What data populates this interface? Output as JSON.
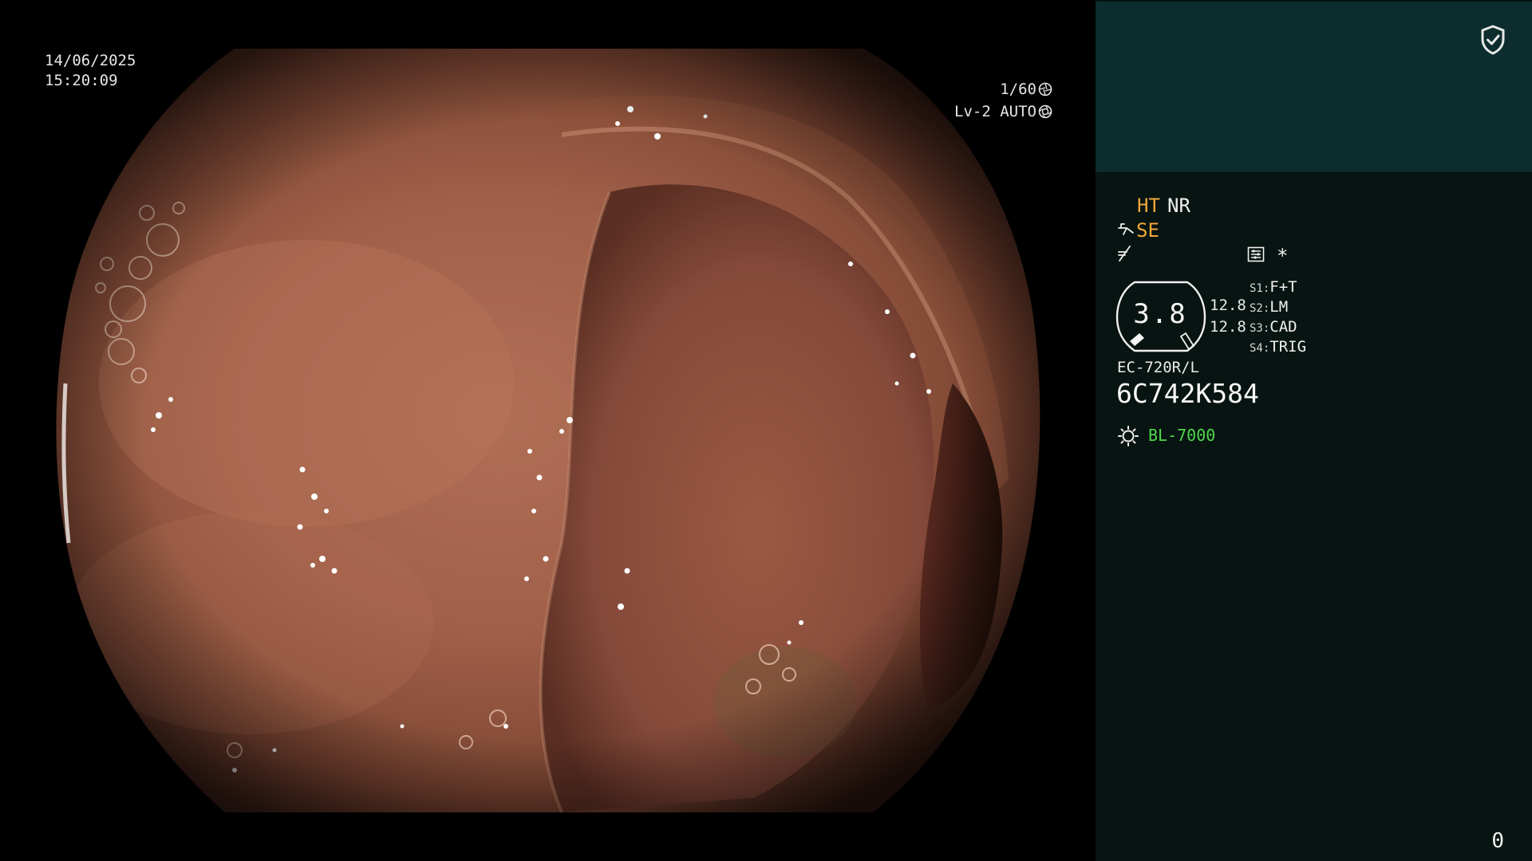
{
  "video": {
    "date": "14/06/2025",
    "time": "15:20:09",
    "shutter": "1/60",
    "shutter_icon": "aperture-icon",
    "level": "Lv-2 AUTO",
    "iris_icon": "iris-icon"
  },
  "panel": {
    "enhancement_label": "HT",
    "noise_reduction_label": "NR",
    "structure_label": "SE",
    "structure_icon": "structure-enhancement-icon",
    "freeze_icon": "freeze-icon",
    "record_icon": "record-settings-icon",
    "asterisk": "*",
    "dial_value": "3.8",
    "zoom_values": [
      "12.8",
      "12.8"
    ],
    "switches": [
      {
        "key": "S1",
        "value": "F+T"
      },
      {
        "key": "S2",
        "value": "LM"
      },
      {
        "key": "S3",
        "value": "CAD"
      },
      {
        "key": "S4",
        "value": "TRIG"
      }
    ],
    "scope_model": "EC-720R/L",
    "scope_serial": "6C742K584",
    "light_source_icon": "light-source-icon",
    "light_source": "BL-7000",
    "counter": "0",
    "shield_icon": "shield-check-icon"
  },
  "colors": {
    "panel_background": "#071412",
    "panel_header": "#0c2c2d",
    "orange_label": "#f2a63a",
    "light_source_green": "#4fd84a",
    "tissue_base": "#a26248"
  }
}
